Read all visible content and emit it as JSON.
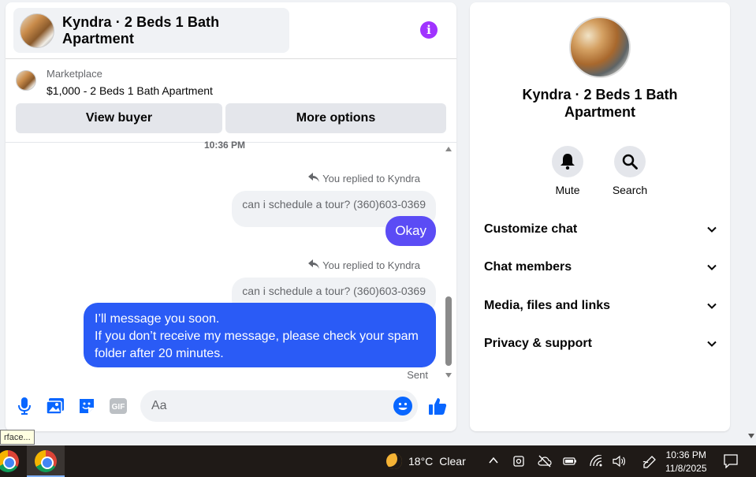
{
  "chat_header": {
    "title": "Kyndra · 2 Beds 1 Bath Apartment",
    "info_icon": "i"
  },
  "marketplace": {
    "label": "Marketplace",
    "listing": "$1,000 - 2 Beds 1 Bath Apartment",
    "view_buyer": "View buyer",
    "more_options": "More options"
  },
  "messages": {
    "timestamp": "10:36 PM",
    "reply1_note": "You replied to Kyndra",
    "reply1_quote": "can i schedule a tour? (360)603-0369",
    "reply1_text": "Okay",
    "reply2_note": "You replied to Kyndra",
    "reply2_quote": "can i schedule a tour? (360)603-0369",
    "reply2_line1": "I’ll message you soon.",
    "reply2_line2": "If you don’t receive my message, please check your spam",
    "reply2_line3": "folder after 20 minutes.",
    "status": "Sent"
  },
  "composer": {
    "placeholder": "Aa",
    "gif_label": "GIF"
  },
  "tooltip": {
    "text": "rface..."
  },
  "info_panel": {
    "title": "Kyndra · 2 Beds 1 Bath Apartment",
    "mute": "Mute",
    "search": "Search",
    "sections": [
      "Customize chat",
      "Chat members",
      "Media, files and links",
      "Privacy & support"
    ]
  },
  "taskbar": {
    "temperature": "18°C",
    "weather": "Clear",
    "time": "10:36 PM",
    "date": "11/8/2025"
  },
  "colors": {
    "accent": "#0866ff",
    "bubble_okay": "#5b4cf5",
    "bubble_long": "#2a5bf6",
    "info_purple": "#a033ff"
  }
}
